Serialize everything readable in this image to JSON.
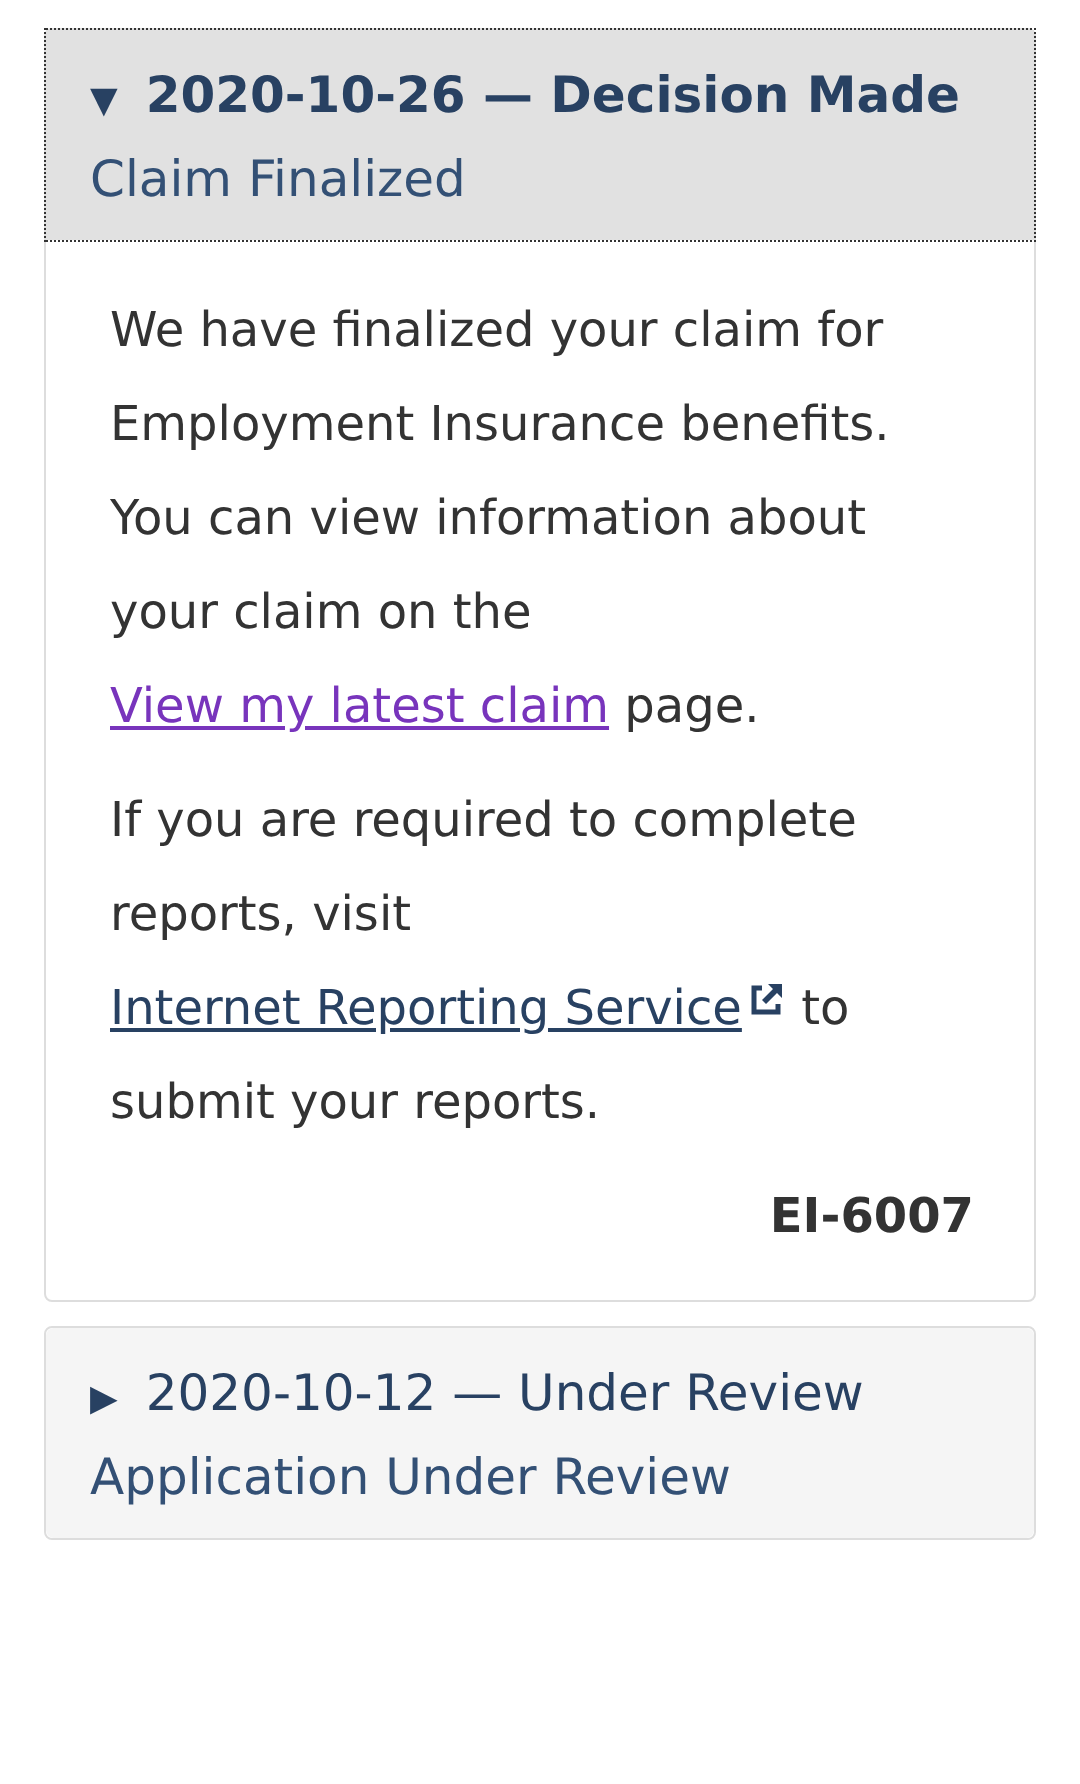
{
  "entries": [
    {
      "toggle": "▼",
      "title": "2020-10-26 — Decision Made",
      "subtitle": "Claim Finalized",
      "expanded": true,
      "focused": true,
      "paragraphs": [
        [
          {
            "kind": "text",
            "text": "We have finalized your claim for Employment Insurance benefits. You can view information about your claim on the "
          },
          {
            "kind": "link",
            "text": "View my latest claim",
            "visited": true,
            "external": false
          },
          {
            "kind": "text",
            "text": " page."
          }
        ],
        [
          {
            "kind": "text",
            "text": "If you are required to complete reports, visit "
          },
          {
            "kind": "link",
            "text": "Internet Reporting Service",
            "visited": false,
            "external": true
          },
          {
            "kind": "text",
            "text": " to submit your reports."
          }
        ]
      ],
      "code": "EI-6007"
    },
    {
      "toggle": "▶",
      "title": "2020-10-12 — Under Review",
      "subtitle": "Application Under Review",
      "expanded": false,
      "focused": false
    }
  ]
}
